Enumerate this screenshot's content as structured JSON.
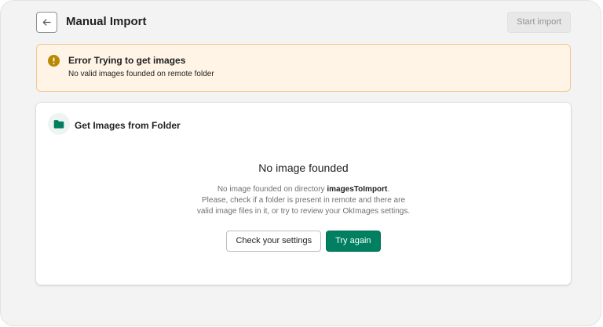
{
  "header": {
    "title": "Manual Import",
    "start_label": "Start import",
    "back_icon": "arrow-left-icon"
  },
  "banner": {
    "title": "Error Trying to get images",
    "description": "No valid images founded on remote folder",
    "icon": "warning-circle-icon",
    "color": "#b98900"
  },
  "card": {
    "title": "Get Images from Folder",
    "icon": "folder-icon",
    "empty_title": "No image founded",
    "desc_line1_prefix": "No image founded on directory ",
    "desc_directory": "imagesToImport",
    "desc_line1_suffix": ".",
    "desc_line2": "Please, check if a folder is present in remote and there are",
    "desc_line3": "valid image files in it, or try to review your OkImages settings.",
    "settings_label": "Check your settings",
    "retry_label": "Try again"
  },
  "colors": {
    "primary": "#008060",
    "warning_bg": "#fff4e5",
    "warning_border": "#f2c791"
  }
}
